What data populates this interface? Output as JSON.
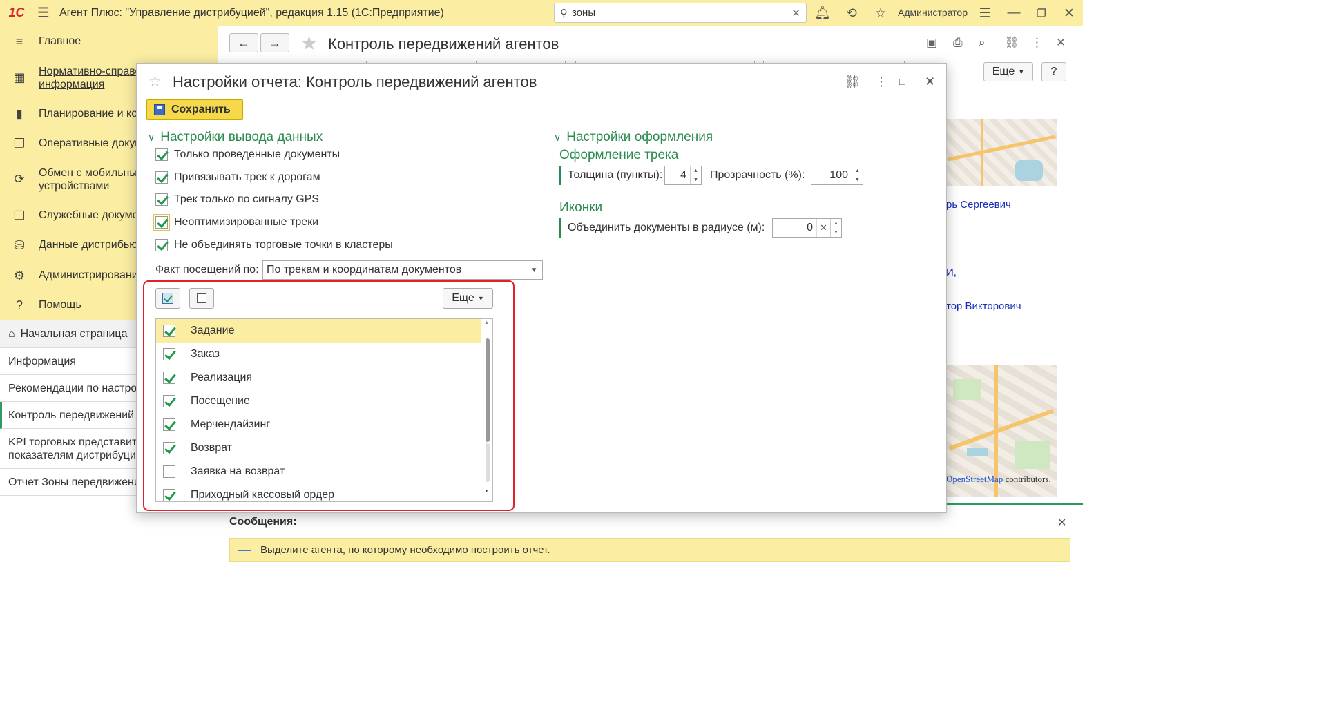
{
  "topbar": {
    "logo": "1С",
    "title": "Агент Плюс: \"Управление дистрибуцией\", редакция 1.15  (1С:Предприятие)",
    "search_value": "зоны",
    "user": "Администратор"
  },
  "sidebar": {
    "items": [
      {
        "label": "Главное",
        "icon": "menu-icon"
      },
      {
        "label": "Нормативно-справочная информация",
        "icon": "grid-icon"
      },
      {
        "label": "Планирование и контроль",
        "icon": "chart-icon"
      },
      {
        "label": "Оперативные документы",
        "icon": "documents-icon"
      },
      {
        "label": "Обмен с мобильными устройствами",
        "icon": "sync-icon"
      },
      {
        "label": "Служебные документы",
        "icon": "files-icon"
      },
      {
        "label": "Данные дистрибьютора",
        "icon": "database-icon"
      },
      {
        "label": "Администрирование",
        "icon": "gear-icon"
      },
      {
        "label": "Помощь",
        "icon": "question-icon"
      }
    ],
    "nav_lines": {
      "item1_line1": "Нормативно-справочная",
      "item1_line2": "информация",
      "item4_line1": "Обмен с мобильными",
      "item4_line2": "устройствами"
    },
    "open_windows": [
      "Начальная страница",
      "Информация",
      "Рекомендации по настройке",
      "Контроль передвижений агентов",
      "KPI торговых представителей по показателям дистрибуции",
      "Отчет Зоны передвижения"
    ],
    "kpi_line1": "KPI торговых представителей по",
    "kpi_line2": "показателям дистрибуции"
  },
  "main": {
    "title": "Контроль передвижений агентов",
    "more_label": "Еще",
    "help_label": "?",
    "bg_texts": [
      "рь Сергеевич",
      "И,",
      "тор Викторович"
    ],
    "map_credit_link": "OpenStreetMap",
    "map_credit_rest": " contributors.",
    "messages_title": "Сообщения:",
    "message_text": "Выделите агента, по которому необходимо построить отчет."
  },
  "dialog": {
    "title": "Настройки отчета: Контроль передвижений агентов",
    "save_label": "Сохранить",
    "output_section": "Настройки вывода данных",
    "checkboxes": [
      {
        "label": "Только проведенные документы",
        "checked": true
      },
      {
        "label": "Привязывать трек к дорогам",
        "checked": true
      },
      {
        "label": "Трек только по сигналу GPS",
        "checked": true
      },
      {
        "label": "Неоптимизированные треки",
        "checked": true
      },
      {
        "label": "Не объединять торговые точки в кластеры",
        "checked": true
      }
    ],
    "visit_label": "Факт посещений по:",
    "visit_value": "По трекам и координатам документов",
    "design_section": "Настройки оформления",
    "track_subtitle": "Оформление трека",
    "thickness_label": "Толщина (пункты):",
    "thickness_value": "4",
    "opacity_label": "Прозрачность (%):",
    "opacity_value": "100",
    "icons_subtitle": "Иконки",
    "radius_label": "Объединить документы в радиусе (м):",
    "radius_value": "0",
    "more_label": "Еще",
    "doc_types": [
      {
        "label": "Задание",
        "checked": true,
        "selected": true
      },
      {
        "label": "Заказ",
        "checked": true
      },
      {
        "label": "Реализация",
        "checked": true
      },
      {
        "label": "Посещение",
        "checked": true
      },
      {
        "label": "Мерчендайзинг",
        "checked": true
      },
      {
        "label": "Возврат",
        "checked": true
      },
      {
        "label": "Заявка на возврат",
        "checked": false
      },
      {
        "label": "Приходный кассовый ордер",
        "checked": true
      }
    ]
  },
  "colors": {
    "accent_yellow": "#fbeea3",
    "section_green": "#2b8a4e",
    "highlight_red": "#e0202a"
  }
}
